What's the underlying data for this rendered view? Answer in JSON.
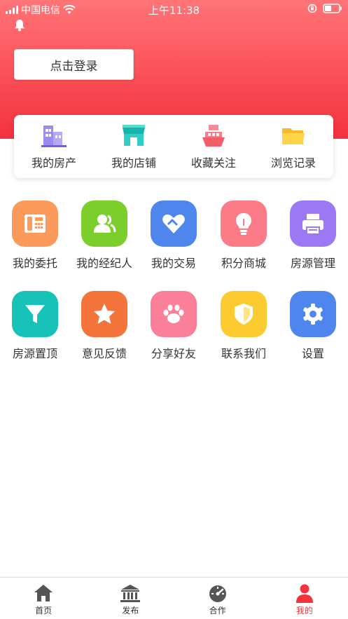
{
  "status_bar": {
    "carrier": "中国电信",
    "time": "上午11:38"
  },
  "header": {
    "login_label": "点击登录"
  },
  "quick_card": {
    "items": [
      {
        "label": "我的房产",
        "icon": "building-icon"
      },
      {
        "label": "我的店铺",
        "icon": "store-icon"
      },
      {
        "label": "收藏关注",
        "icon": "ship-icon"
      },
      {
        "label": "浏览记录",
        "icon": "folder-icon"
      }
    ]
  },
  "menu": {
    "items": [
      {
        "label": "我的委托",
        "icon": "phone-icon",
        "color": "#fb9a5a"
      },
      {
        "label": "我的经纪人",
        "icon": "user-icon",
        "color": "#7ccf2a"
      },
      {
        "label": "我的交易",
        "icon": "handshake-heart-icon",
        "color": "#4f86ee"
      },
      {
        "label": "积分商城",
        "icon": "lightbulb-icon",
        "color": "#fb7c86"
      },
      {
        "label": "房源管理",
        "icon": "printer-icon",
        "color": "#9b79f5"
      },
      {
        "label": "房源置顶",
        "icon": "funnel-icon",
        "color": "#17c3b8"
      },
      {
        "label": "意见反馈",
        "icon": "star-icon",
        "color": "#f4743b"
      },
      {
        "label": "分享好友",
        "icon": "paw-icon",
        "color": "#fb7f99"
      },
      {
        "label": "联系我们",
        "icon": "shield-icon",
        "color": "#fccb2f"
      },
      {
        "label": "设置",
        "icon": "gear-icon",
        "color": "#4f86ee"
      }
    ]
  },
  "tabbar": {
    "tabs": [
      {
        "label": "首页",
        "icon": "home-icon"
      },
      {
        "label": "发布",
        "icon": "bank-icon"
      },
      {
        "label": "合作",
        "icon": "gauge-icon"
      },
      {
        "label": "我的",
        "icon": "person-icon",
        "active": true
      }
    ]
  },
  "colors": {
    "accent": "#f3323f",
    "hero_top": "#ff7477"
  }
}
